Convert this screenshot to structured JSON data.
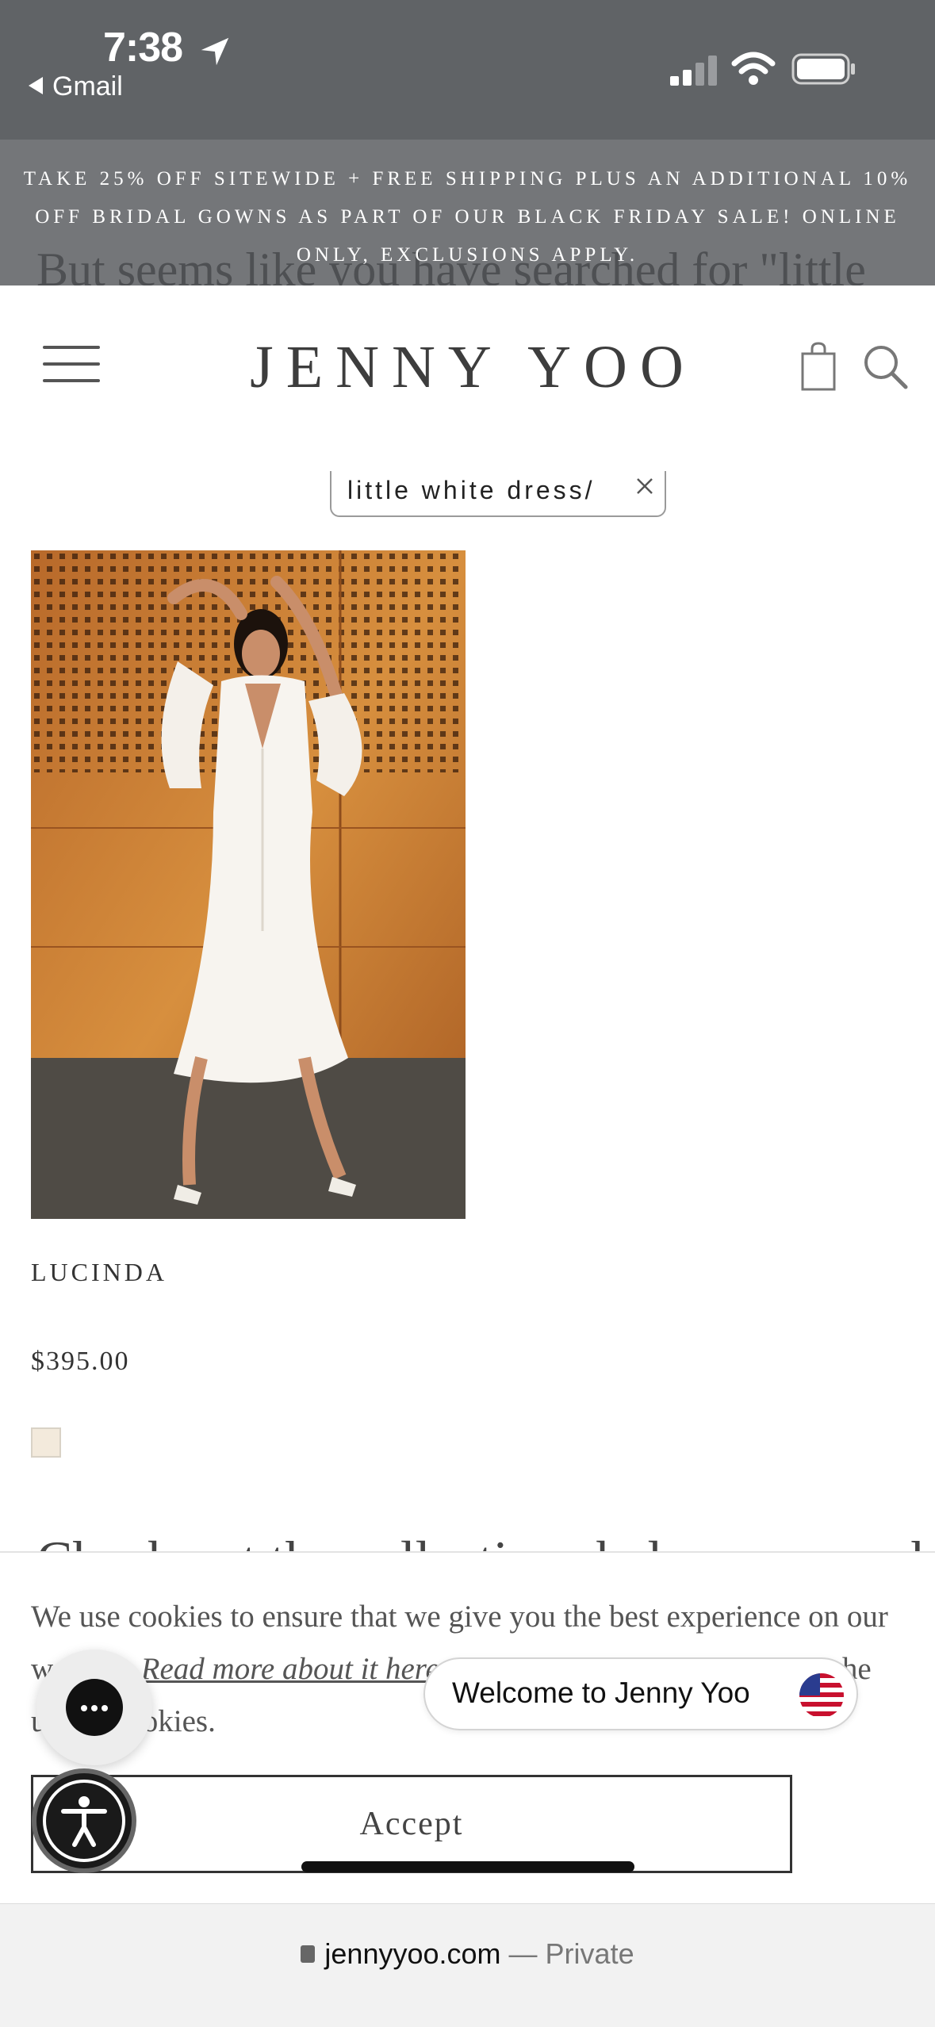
{
  "status_bar": {
    "time": "7:38",
    "back_app": "Gmail"
  },
  "promo": {
    "text": "TAKE 25% OFF SITEWIDE + FREE SHIPPING PLUS AN ADDITIONAL 10% OFF BRIDAL GOWNS AS PART OF OUR BLACK FRIDAY SALE! ONLINE ONLY, EXCLUSIONS APPLY.",
    "behind_text": "But seems like you have searched for \"little"
  },
  "header": {
    "logo": "JENNY YOO"
  },
  "search_tag": {
    "label": "little white dress/"
  },
  "product": {
    "name": "LUCINDA",
    "price": "$395.00",
    "swatch_color": "#f3eadc"
  },
  "behind_cookie_text": "Check out the collections below or search",
  "cookie": {
    "text_before_link": "We use cookies to ensure that we give you the best experience on our website. ",
    "link": "Read more about it here",
    "text_after_link": ". By using our site you agree to the use of cookies.",
    "accept_label": "Accept"
  },
  "welcome_widget": {
    "label": "Welcome to Jenny Yoo"
  },
  "url_bar": {
    "domain": "jennyyoo.com",
    "separator": " — ",
    "mode": "Private"
  },
  "colors": {
    "status_bar_bg": "#606366",
    "promo_bg": "#747679",
    "accent_text": "#3a3a3a"
  }
}
